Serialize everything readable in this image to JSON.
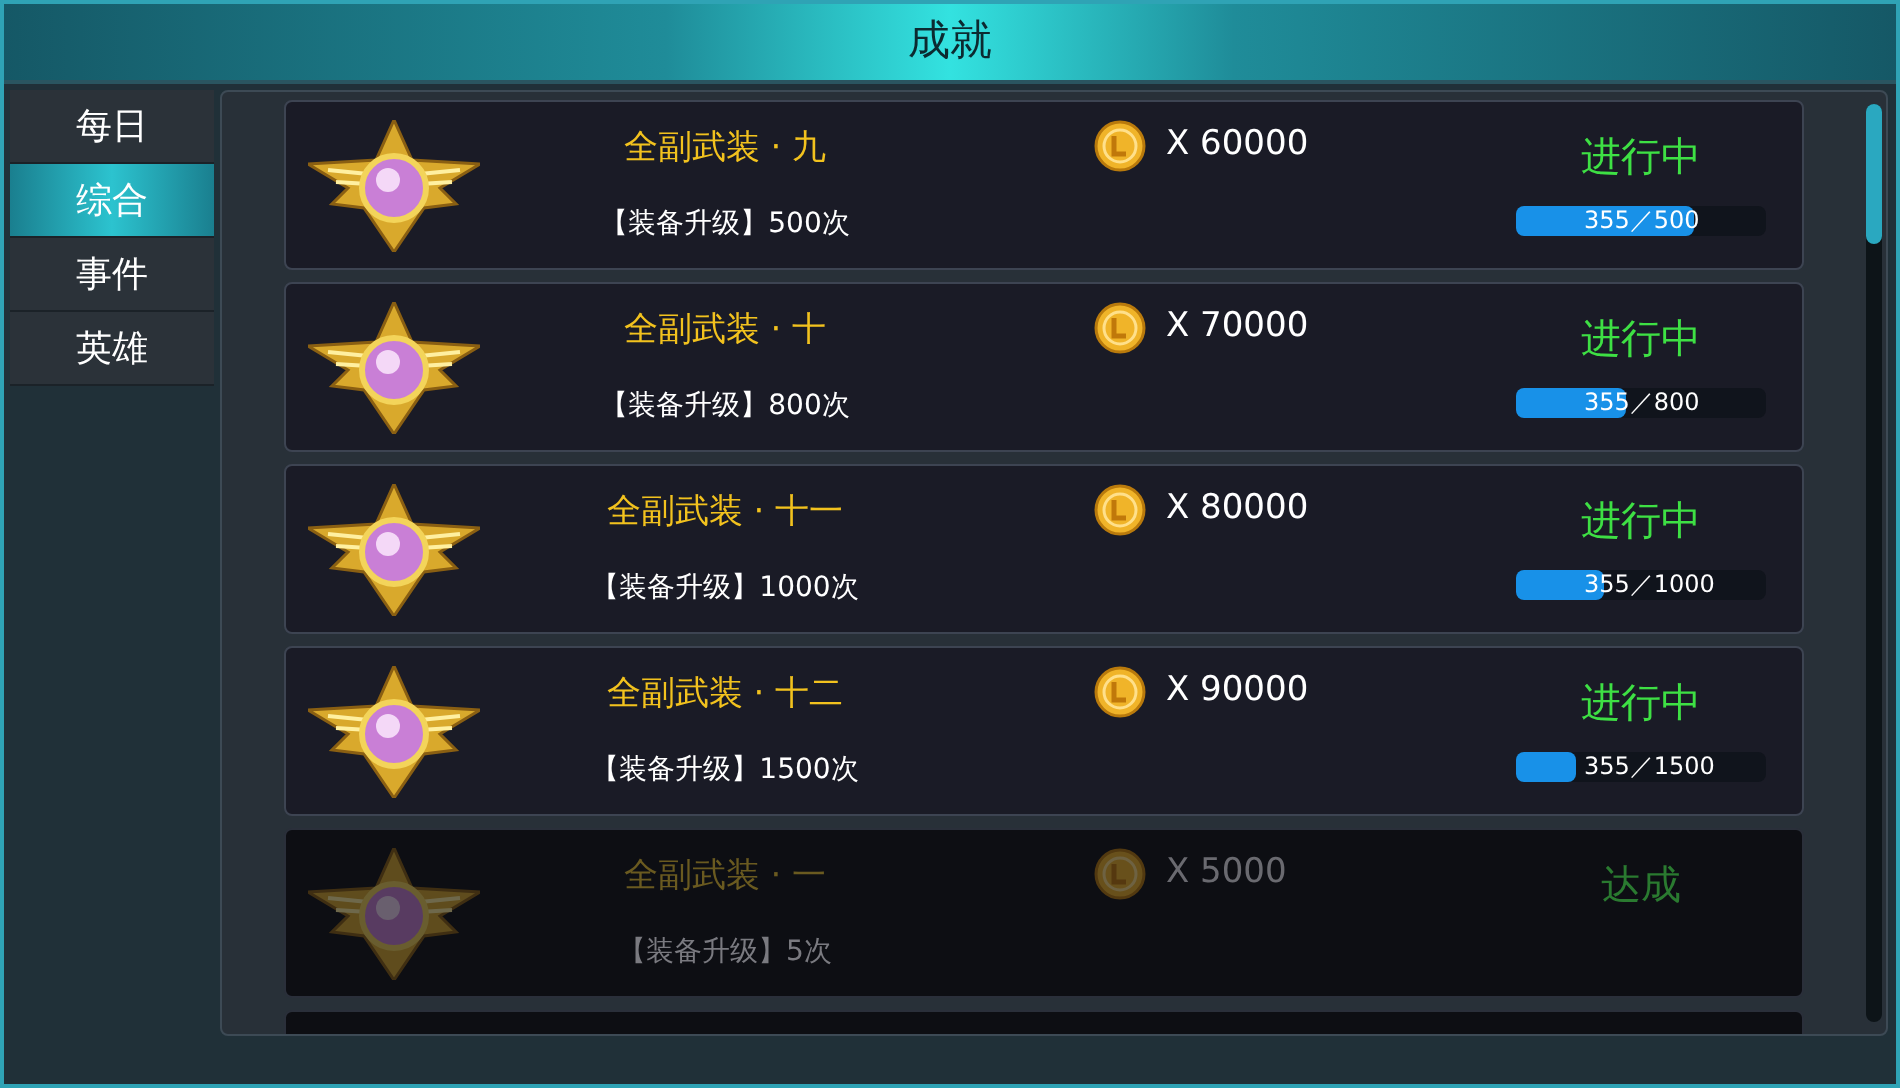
{
  "window": {
    "title": "成就"
  },
  "tabs": [
    {
      "label": "每日",
      "selected": false
    },
    {
      "label": "综合",
      "selected": true
    },
    {
      "label": "事件",
      "selected": false
    },
    {
      "label": "英雄",
      "selected": false
    }
  ],
  "achievements": [
    {
      "title": "全副武装 · 九",
      "requirement": "【装备升级】500次",
      "reward": "X 60000",
      "status": "进行中",
      "achieved": false,
      "level": 0.71,
      "progress": "355／500"
    },
    {
      "title": "全副武装 · 十",
      "requirement": "【装备升级】800次",
      "reward": "X 70000",
      "status": "进行中",
      "achieved": false,
      "level": 0.44,
      "progress": "355／800"
    },
    {
      "title": "全副武装 · 十一",
      "requirement": "【装备升级】1000次",
      "reward": "X 80000",
      "status": "进行中",
      "achieved": false,
      "level": 0.355,
      "progress": "355／1000"
    },
    {
      "title": "全副武装 · 十二",
      "requirement": "【装备升级】1500次",
      "reward": "X 90000",
      "status": "进行中",
      "achieved": false,
      "level": 0.237,
      "progress": "355／1500"
    },
    {
      "title": "全副武装 · 一",
      "requirement": "【装备升级】5次",
      "reward": "X 5000",
      "status": "达成",
      "achieved": true
    }
  ]
}
